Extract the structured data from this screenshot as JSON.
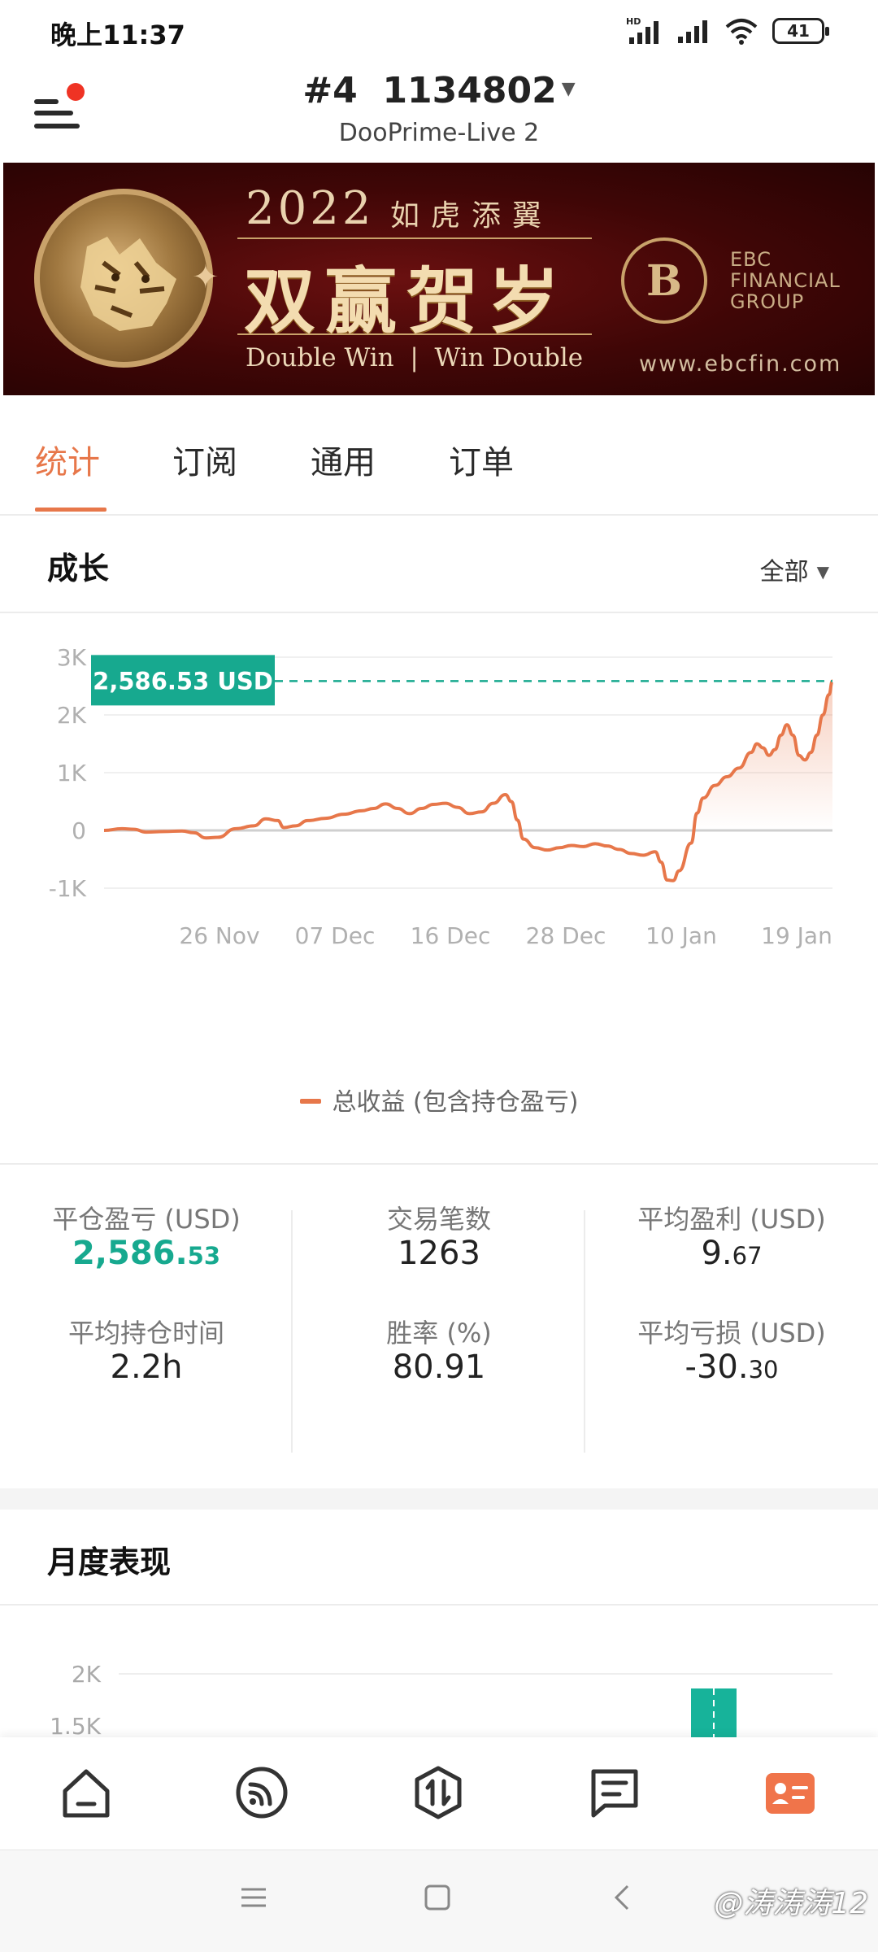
{
  "status_bar": {
    "time": "晚上11:37",
    "battery": "41",
    "signal_label": "HD"
  },
  "header": {
    "account_prefix": "#4",
    "account_number": "1134802",
    "server": "DooPrime-Live 2"
  },
  "banner": {
    "year": "2022",
    "motto": "如虎添翼",
    "headline": "双赢贺岁",
    "english": "Double Win  |  Win Double",
    "brand_lines": [
      "EBC",
      "FINANCIAL",
      "GROUP"
    ],
    "url": "www.ebcfin.com"
  },
  "tabs": [
    {
      "label": "统计",
      "active": true
    },
    {
      "label": "订阅",
      "active": false
    },
    {
      "label": "通用",
      "active": false
    },
    {
      "label": "订单",
      "active": false
    }
  ],
  "growth": {
    "title": "成长",
    "filter": "全部",
    "current_label": "2,586.53 USD",
    "legend": "总收益 (包含持仓盈亏)"
  },
  "chart_data": {
    "type": "area",
    "ylim": [
      -1000,
      3000
    ],
    "y_ticks": [
      "3K",
      "2K",
      "1K",
      "0",
      "-1K"
    ],
    "x_ticks": [
      "26 Nov",
      "07 Dec",
      "16 Dec",
      "28 Dec",
      "10 Jan",
      "19 Jan"
    ],
    "series": [
      {
        "name": "总收益 (包含持仓盈亏)",
        "color": "#e7774a",
        "points": [
          [
            0,
            0
          ],
          [
            3,
            30
          ],
          [
            5,
            20
          ],
          [
            7,
            -30
          ],
          [
            10,
            -20
          ],
          [
            13,
            -10
          ],
          [
            15,
            -40
          ],
          [
            17,
            -130
          ],
          [
            19,
            -120
          ],
          [
            22,
            30
          ],
          [
            25,
            80
          ],
          [
            27,
            200
          ],
          [
            29,
            170
          ],
          [
            30,
            50
          ],
          [
            32,
            80
          ],
          [
            34,
            170
          ],
          [
            37,
            210
          ],
          [
            40,
            280
          ],
          [
            43,
            340
          ],
          [
            45,
            380
          ],
          [
            47,
            460
          ],
          [
            49,
            380
          ],
          [
            51,
            290
          ],
          [
            53,
            380
          ],
          [
            55,
            450
          ],
          [
            57,
            470
          ],
          [
            59,
            400
          ],
          [
            61,
            290
          ],
          [
            63,
            320
          ],
          [
            65,
            470
          ],
          [
            67,
            620
          ],
          [
            68,
            500
          ],
          [
            69,
            180
          ],
          [
            70,
            -150
          ],
          [
            72,
            -300
          ],
          [
            74,
            -340
          ],
          [
            76,
            -300
          ],
          [
            78,
            -260
          ],
          [
            80,
            -280
          ],
          [
            82,
            -230
          ],
          [
            84,
            -270
          ],
          [
            86,
            -330
          ],
          [
            88,
            -400
          ],
          [
            90,
            -430
          ],
          [
            92,
            -370
          ],
          [
            93,
            -550
          ],
          [
            94,
            -860
          ],
          [
            95,
            -870
          ],
          [
            96,
            -700
          ],
          [
            98,
            -220
          ],
          [
            99,
            300
          ],
          [
            100,
            560
          ],
          [
            102,
            780
          ],
          [
            104,
            930
          ],
          [
            106,
            1080
          ],
          [
            108,
            1350
          ],
          [
            109,
            1500
          ],
          [
            110,
            1430
          ],
          [
            111,
            1300
          ],
          [
            112,
            1400
          ],
          [
            113,
            1650
          ],
          [
            114,
            1830
          ],
          [
            115,
            1650
          ],
          [
            116,
            1300
          ],
          [
            117,
            1220
          ],
          [
            118,
            1350
          ],
          [
            119,
            1650
          ],
          [
            120,
            2000
          ],
          [
            121,
            2350
          ],
          [
            121.6,
            2586.53
          ]
        ]
      }
    ],
    "reference_line": 2586.53
  },
  "stats": [
    {
      "label": "平仓盈亏 (USD)",
      "value_main": "2,586.",
      "value_dec": "53",
      "highlight": true
    },
    {
      "label": "交易笔数",
      "value_main": "1263",
      "value_dec": "",
      "highlight": false
    },
    {
      "label": "平均盈利 (USD)",
      "value_main": "9.",
      "value_dec": "67",
      "highlight": false
    },
    {
      "label": "平均持仓时间",
      "value_main": "2.2h",
      "value_dec": "",
      "highlight": false
    },
    {
      "label": "胜率 (%)",
      "value_main": "80.91",
      "value_dec": "",
      "highlight": false
    },
    {
      "label": "平均亏损 (USD)",
      "value_main": "-30.",
      "value_dec": "30",
      "highlight": false
    }
  ],
  "monthly": {
    "title": "月度表现",
    "y_ticks": [
      "2K",
      "1.5K"
    ]
  },
  "bottom_nav": [
    "home-icon",
    "feed-icon",
    "trade-icon",
    "orders-icon",
    "account-card-icon"
  ],
  "watermark": "@涛涛涛12"
}
